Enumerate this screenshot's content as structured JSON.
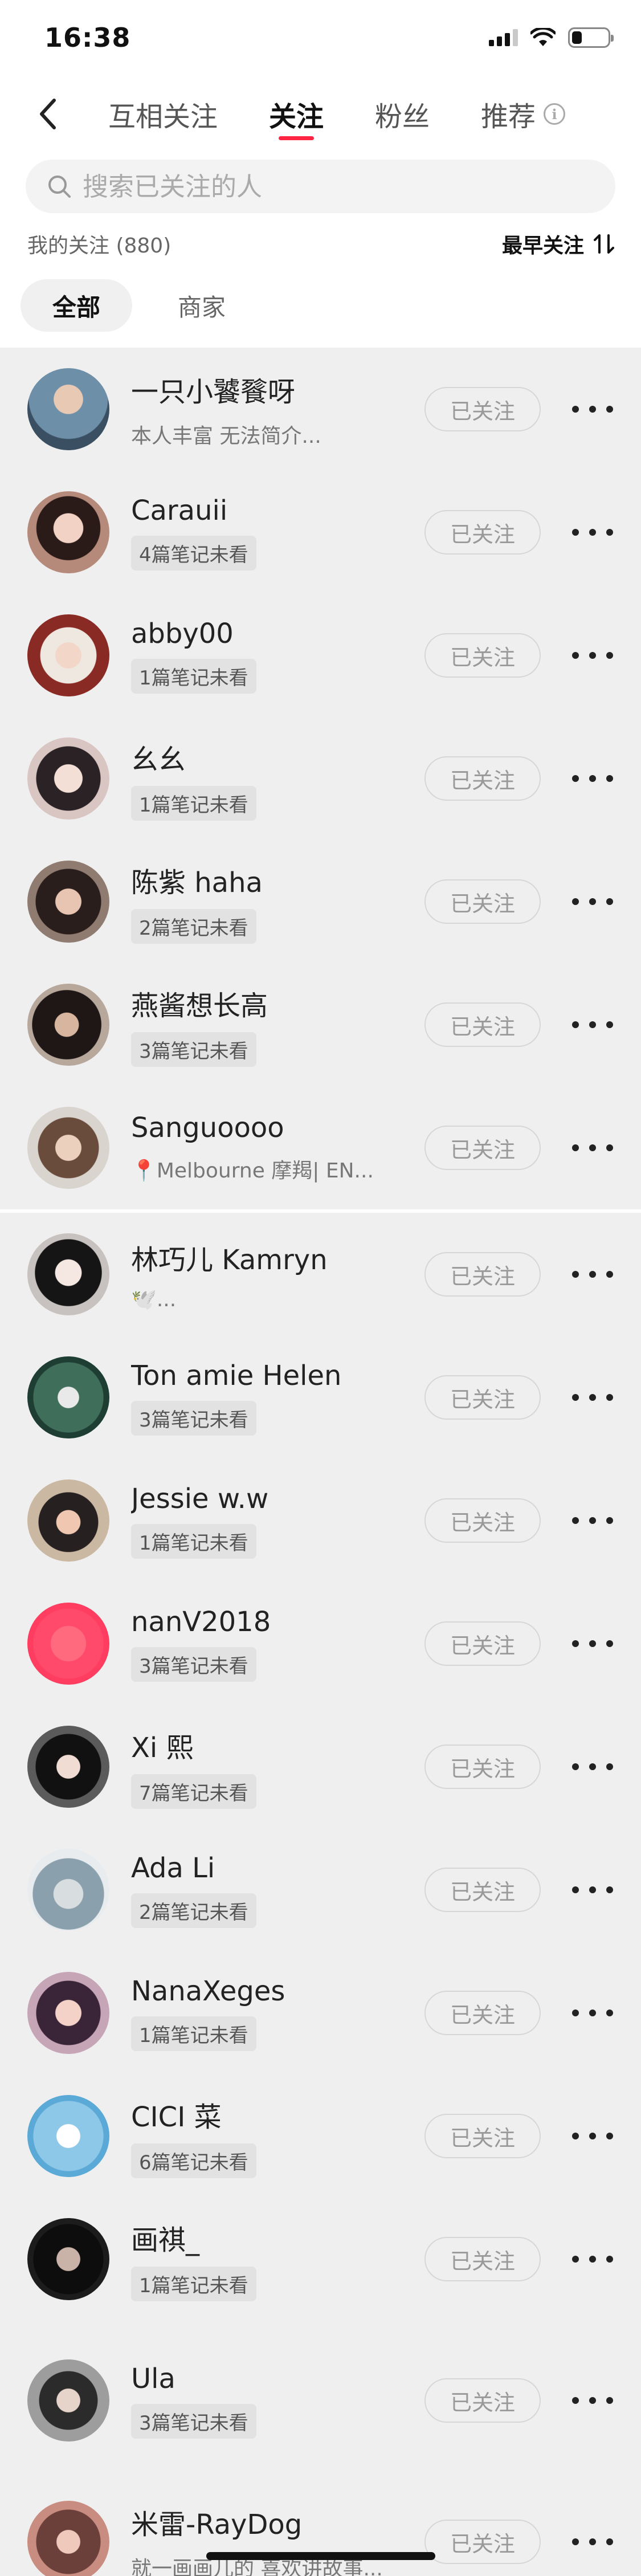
{
  "status_bar": {
    "time": "16:38"
  },
  "nav": {
    "tabs": [
      {
        "label": "互相关注",
        "active": false
      },
      {
        "label": "关注",
        "active": true
      },
      {
        "label": "粉丝",
        "active": false
      },
      {
        "label": "推荐",
        "active": false
      }
    ]
  },
  "search": {
    "placeholder": "搜索已关注的人"
  },
  "meta": {
    "count_label": "我的关注 (880)",
    "sort_label": "最早关注"
  },
  "filters": [
    {
      "label": "全部",
      "active": true
    },
    {
      "label": "商家",
      "active": false
    }
  ],
  "follow_label": "已关注",
  "colors": {
    "accent": "#ff2442",
    "background": "#ededed"
  },
  "users": [
    {
      "name": "一只小饕餮呀",
      "sub": "本人丰富 无法简介...",
      "sub_type": "text"
    },
    {
      "name": "Carauii",
      "sub": "4篇笔记未看",
      "sub_type": "tag"
    },
    {
      "name": "abby00",
      "sub": "1篇笔记未看",
      "sub_type": "tag"
    },
    {
      "name": "幺幺",
      "sub": "1篇笔记未看",
      "sub_type": "tag"
    },
    {
      "name": "陈紫 haha",
      "sub": "2篇笔记未看",
      "sub_type": "tag"
    },
    {
      "name": "燕酱想长高",
      "sub": "3篇笔记未看",
      "sub_type": "tag"
    },
    {
      "name": "Sanguoooo",
      "sub": "📍Melbourne 摩羯| EN...",
      "sub_type": "text"
    },
    {
      "name": "林巧儿 Kamryn",
      "sub": "🕊️...",
      "sub_type": "text"
    },
    {
      "name": "Ton amie Helen",
      "sub": "3篇笔记未看",
      "sub_type": "tag"
    },
    {
      "name": "Jessie w.w",
      "sub": "1篇笔记未看",
      "sub_type": "tag"
    },
    {
      "name": "nanV2018",
      "sub": "3篇笔记未看",
      "sub_type": "tag"
    },
    {
      "name": "Xi 熙",
      "sub": "7篇笔记未看",
      "sub_type": "tag"
    },
    {
      "name": "Ada Li",
      "sub": "2篇笔记未看",
      "sub_type": "tag"
    },
    {
      "name": "NanaXeges",
      "sub": "1篇笔记未看",
      "sub_type": "tag"
    },
    {
      "name": "CICI 菜",
      "sub": "6篇笔记未看",
      "sub_type": "tag"
    },
    {
      "name": "画祺_",
      "sub": "1篇笔记未看",
      "sub_type": "tag"
    },
    {
      "name": "Ula",
      "sub": "3篇笔记未看",
      "sub_type": "tag"
    },
    {
      "name": "米雷-RayDog",
      "sub": "就一画画儿的 喜欢讲故事...",
      "sub_type": "text"
    }
  ]
}
